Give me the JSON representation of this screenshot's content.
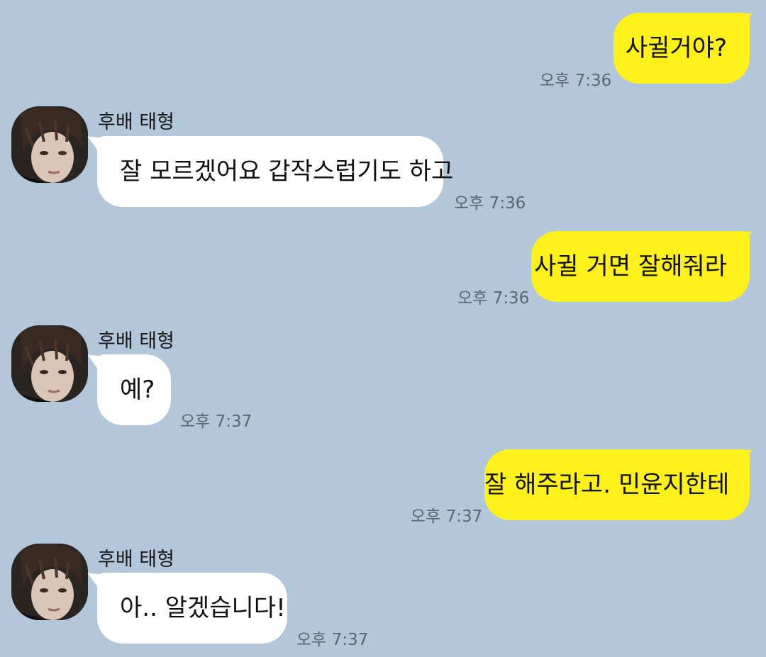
{
  "chat": {
    "messages": [
      {
        "direction": "out",
        "text": "사귈거야?",
        "time": "오후 7:36"
      },
      {
        "direction": "in",
        "sender": "후배 태형",
        "text": "잘 모르겠어요 갑작스럽기도 하고",
        "time": "오후 7:36"
      },
      {
        "direction": "out",
        "text": "사귈 거면 잘해줘라",
        "time": "오후 7:36"
      },
      {
        "direction": "in",
        "sender": "후배 태형",
        "text": "예?",
        "time": "오후 7:37"
      },
      {
        "direction": "out",
        "text": "잘 해주라고. 민윤지한테",
        "time": "오후 7:37"
      },
      {
        "direction": "in",
        "sender": "후배 태형",
        "text": "아.. 알겠습니다!",
        "time": "오후 7:37"
      }
    ]
  },
  "colors": {
    "background": "#b2c7da",
    "outgoing_bubble": "#fef01b",
    "incoming_bubble": "#ffffff",
    "timestamp": "#5a6673"
  },
  "icons": {
    "avatar": "profile-photo"
  }
}
